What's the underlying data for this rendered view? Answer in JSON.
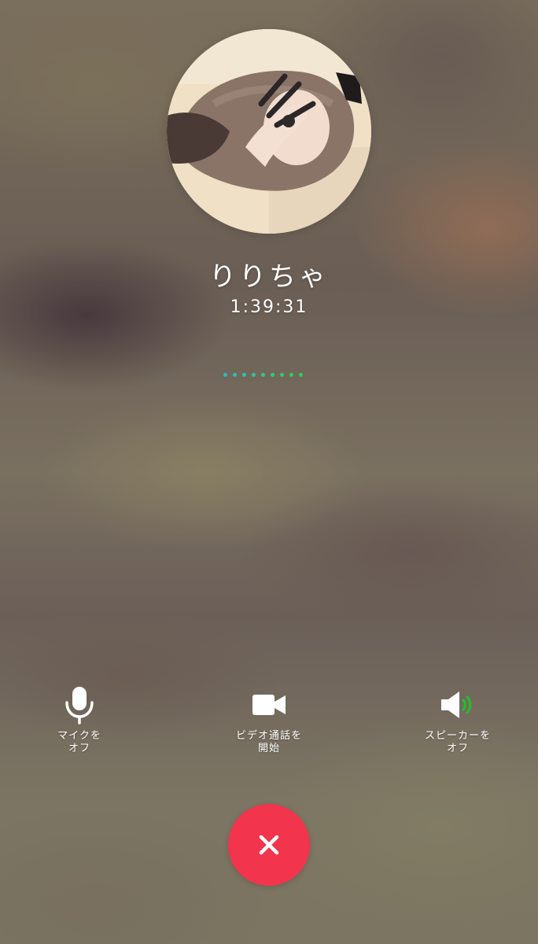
{
  "call": {
    "caller_name": "りりちゃ",
    "duration": "1:39:31"
  },
  "controls": {
    "mic": {
      "label": "マイクを\nオフ",
      "icon": "microphone-icon"
    },
    "video": {
      "label": "ビデオ通話を\n開始",
      "icon": "video-camera-icon"
    },
    "speaker": {
      "label": "スピーカーを\nオフ",
      "icon": "speaker-icon"
    },
    "end_call": {
      "icon": "close-icon"
    }
  },
  "indicator": {
    "dot_count": 9,
    "colors": [
      "#34b4c8",
      "#2fbcba",
      "#2ec1aa",
      "#2dc69a",
      "#2cc98c",
      "#2bcb80",
      "#2acd74",
      "#29ce6a",
      "#28cf62"
    ]
  },
  "colors": {
    "end_call": "#f2354c",
    "speaker_wave": "#22c02a",
    "text": "#ffffff"
  }
}
